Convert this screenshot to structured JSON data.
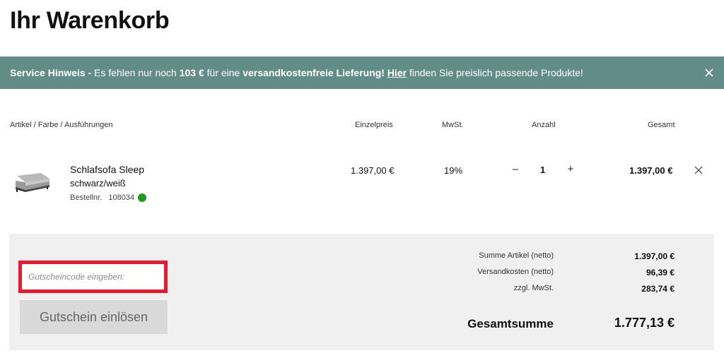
{
  "page": {
    "title": "Ihr Warenkorb"
  },
  "notice": {
    "prefix_bold": "Service Hinweis -",
    "text1": " Es fehlen nur noch ",
    "amount": "103 €",
    "text2": " für eine ",
    "bold_phrase": "versandkostenfreie Lieferung!",
    "link_text": "Hier",
    "text3": " finden Sie preislich passende Produkte!",
    "close_icon": "close-icon",
    "background_color": "#628c88"
  },
  "table": {
    "columns": {
      "article": "Artikel / Farbe / Ausführungen",
      "unit_price": "Einzelpreis",
      "tax": "MwSt.",
      "quantity": "Anzahl",
      "total": "Gesamt"
    }
  },
  "item": {
    "name": "Schlafsofa Sleep",
    "color": "schwarz/weiß",
    "order_label": "Bestellnr.",
    "order_number": "108034",
    "unit_price": "1.397,00 €",
    "tax": "19%",
    "decrement_label": "–",
    "quantity": "1",
    "increment_label": "+",
    "total": "1.397,00 €",
    "availability_color": "#1e9a1e",
    "image_icon": "sofa-thumbnail",
    "remove_icon": "close-icon"
  },
  "voucher": {
    "placeholder": "Gutscheincode eingeben:",
    "value": "",
    "button_label": "Gutschein einlösen",
    "highlight_color": "#e8192c"
  },
  "summary": {
    "subtotal_label": "Summe Artikel (netto)",
    "subtotal_value": "1.397,00 €",
    "shipping_label": "Versandkosten (netto)",
    "shipping_value": "96,39 €",
    "tax_label": "zzgl. MwSt.",
    "tax_value": "283,74 €",
    "grand_total_label": "Gesamtsumme",
    "grand_total_value": "1.777,13 €"
  }
}
